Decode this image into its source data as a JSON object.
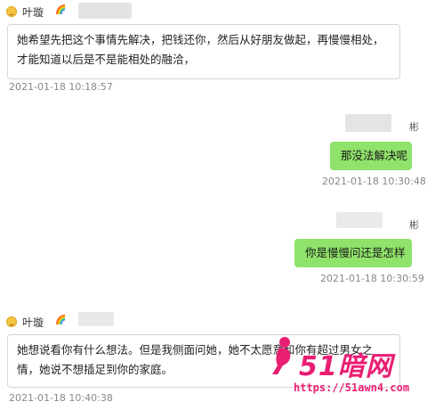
{
  "messages": [
    {
      "side": "left",
      "sender": "叶璇",
      "text_lines": [
        "她希望先把这个事情先解决，把钱还你，然后从好朋友做起，再慢慢相处，",
        "才能知道以后是不是能相处的融洽，"
      ],
      "time": "2021-01-18 10:18:57"
    },
    {
      "side": "right",
      "sender": "彬",
      "text": "那没法解决呢",
      "time": "2021-01-18 10:30:48"
    },
    {
      "side": "right",
      "sender": "彬",
      "text": "你是慢慢问还是怎样",
      "time": "2021-01-18 10:30:59"
    },
    {
      "side": "left",
      "sender": "叶璇",
      "text_lines": [
        "她想说看你有什么想法。但是我侧面问她，她不太愿意和你有超过男女之",
        "情，她说不想插足到你的家庭。"
      ],
      "time": "2021-01-18 10:40:38"
    }
  ],
  "emoji": {
    "face": "smiling-face",
    "rainbow": "🌈"
  },
  "colors": {
    "bubble_right": "#8fe26a",
    "watermark": "#e91e73"
  },
  "watermark": {
    "logo": "51暗网",
    "url": "https://51awn4.com"
  }
}
